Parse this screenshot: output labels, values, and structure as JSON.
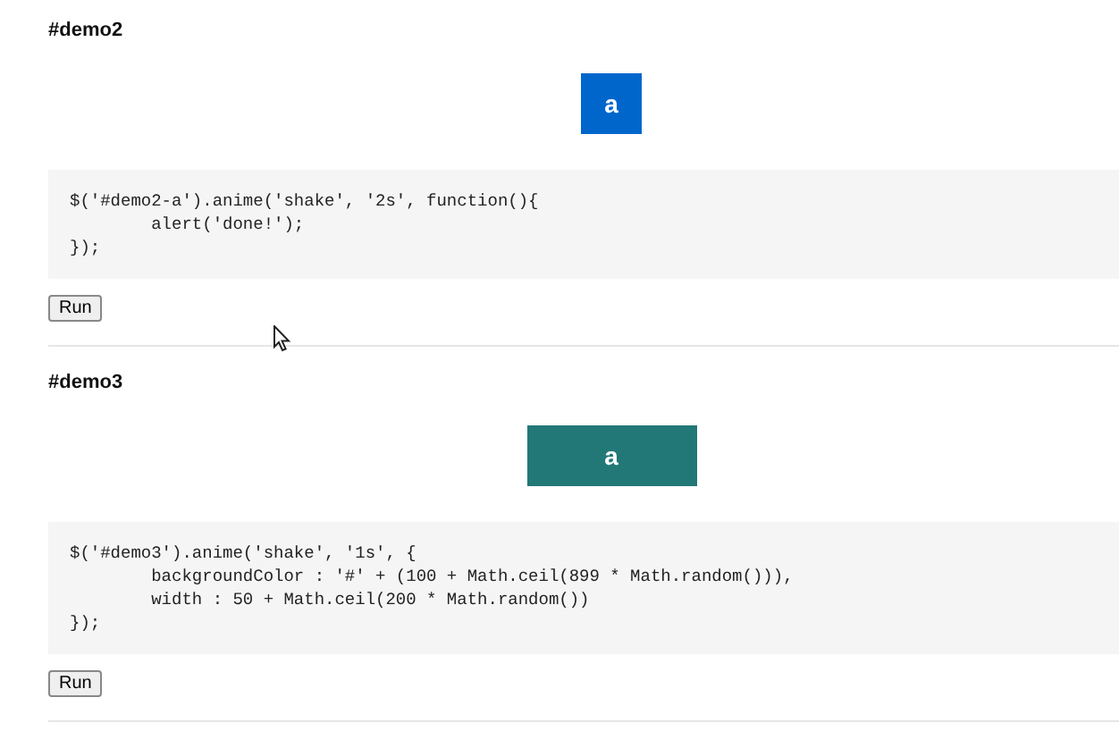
{
  "demos": [
    {
      "heading": "#demo2",
      "box": {
        "label": "a",
        "color": "#0066cc",
        "kind": "square"
      },
      "code": "$('#demo2-a').anime('shake', '2s', function(){\n        alert('done!');\n});",
      "button": "Run"
    },
    {
      "heading": "#demo3",
      "box": {
        "label": "a",
        "color": "#227777",
        "kind": "wide"
      },
      "code": "$('#demo3').anime('shake', '1s', {\n        backgroundColor : '#' + (100 + Math.ceil(899 * Math.random())),\n        width : 50 + Math.ceil(200 * Math.random())\n});",
      "button": "Run"
    }
  ]
}
